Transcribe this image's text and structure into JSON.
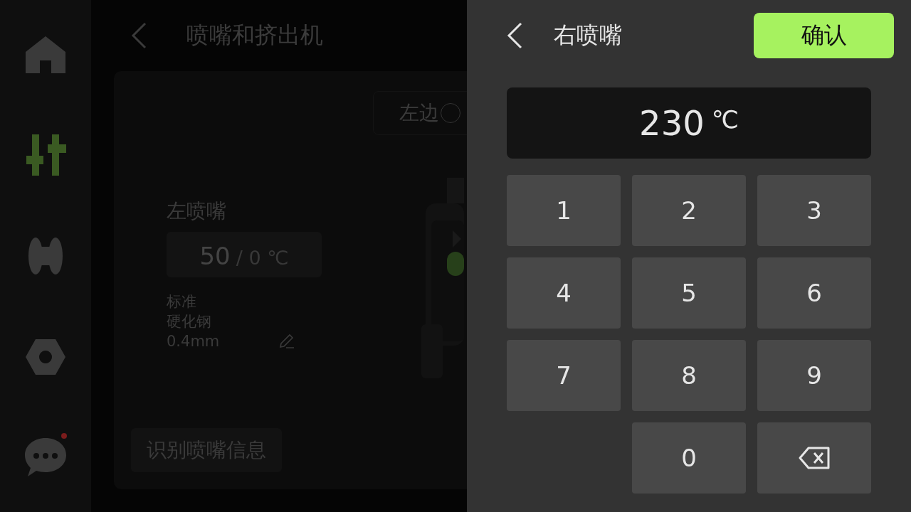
{
  "sidebar": {
    "items": [
      {
        "kind": "home",
        "selected": false
      },
      {
        "kind": "controls",
        "selected": true
      },
      {
        "kind": "spool",
        "selected": false
      },
      {
        "kind": "nut",
        "selected": false
      },
      {
        "kind": "messages",
        "selected": false,
        "badge": true
      }
    ]
  },
  "page": {
    "title": "喷嘴和挤出机",
    "side_switch": {
      "label": "左边",
      "on": false
    },
    "nozzle": {
      "name": "左喷嘴",
      "current_temp": "50",
      "target_temp": "/ 0 ℃",
      "details": [
        "标准",
        "硬化钢",
        "0.4mm"
      ]
    },
    "identify_button": "识别喷嘴信息"
  },
  "keypad_panel": {
    "title": "右喷嘴",
    "confirm": "确认",
    "display": {
      "value": "230",
      "unit": "℃"
    },
    "keys": [
      {
        "kind": "digit",
        "label": "1"
      },
      {
        "kind": "digit",
        "label": "2"
      },
      {
        "kind": "digit",
        "label": "3"
      },
      {
        "kind": "digit",
        "label": "4"
      },
      {
        "kind": "digit",
        "label": "5"
      },
      {
        "kind": "digit",
        "label": "6"
      },
      {
        "kind": "digit",
        "label": "7"
      },
      {
        "kind": "digit",
        "label": "8"
      },
      {
        "kind": "digit",
        "label": "9"
      },
      {
        "kind": "digit",
        "label": "0"
      },
      {
        "kind": "backspace"
      }
    ]
  }
}
